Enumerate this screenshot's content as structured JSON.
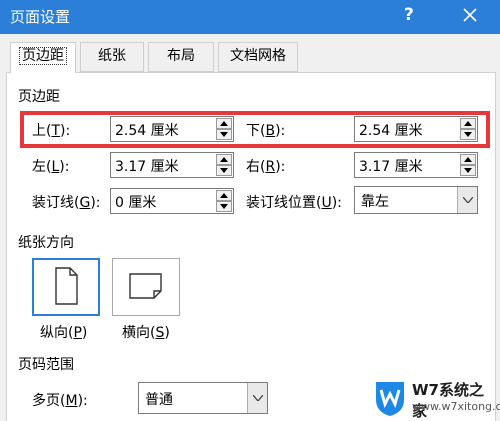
{
  "window": {
    "title": "页面设置",
    "help": "?"
  },
  "tabs": [
    {
      "label": "页边距",
      "active": true
    },
    {
      "label": "纸张",
      "active": false
    },
    {
      "label": "布局",
      "active": false
    },
    {
      "label": "文档网格",
      "active": false
    }
  ],
  "margins": {
    "section_label": "页边距",
    "top": {
      "label": "上(",
      "key": "T",
      "tail": "):",
      "value": "2.54 厘米"
    },
    "bottom": {
      "label": "下(",
      "key": "B",
      "tail": "):",
      "value": "2.54 厘米"
    },
    "left": {
      "label": "左(",
      "key": "L",
      "tail": "):",
      "value": "3.17 厘米"
    },
    "right": {
      "label": "右(",
      "key": "R",
      "tail": "):",
      "value": "3.17 厘米"
    },
    "gutter": {
      "label": "装订线(",
      "key": "G",
      "tail": "):",
      "value": "0 厘米"
    },
    "gutter_pos": {
      "label": "装订线位置(",
      "key": "U",
      "tail": "):",
      "value": "靠左"
    }
  },
  "orientation": {
    "section_label": "纸张方向",
    "portrait": {
      "label": "纵向(",
      "key": "P",
      "tail": ")",
      "selected": true
    },
    "landscape": {
      "label": "横向(",
      "key": "S",
      "tail": ")",
      "selected": false
    }
  },
  "pages": {
    "section_label": "页码范围",
    "multiple": {
      "label": "多页(",
      "key": "M",
      "tail": "):",
      "value": "普通"
    }
  },
  "watermark": {
    "title": "W7系统之家",
    "url": "www.w7xitong.com"
  },
  "colors": {
    "titlebar": "#2b7fd9",
    "highlight": "#e8373a",
    "selected_border": "#2b7fd9"
  }
}
